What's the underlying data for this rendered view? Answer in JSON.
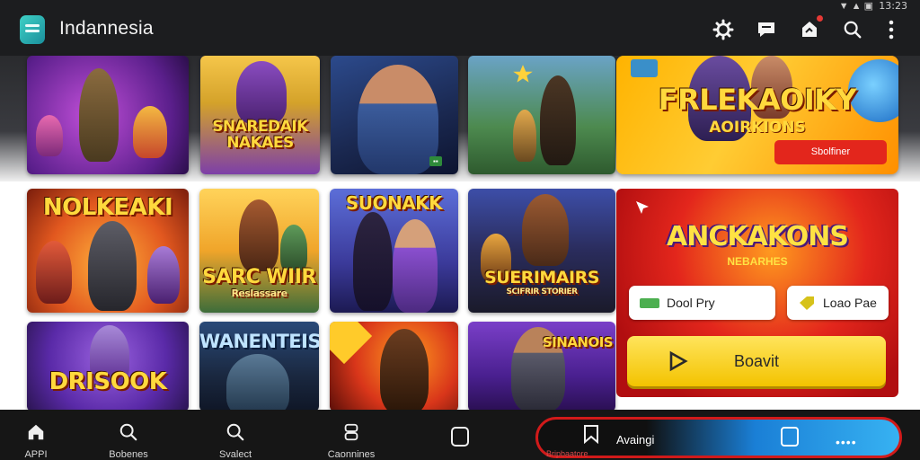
{
  "status": {
    "time": "13:23"
  },
  "header": {
    "title": "Indannesia"
  },
  "icons": {
    "settings": "settings-icon",
    "chat": "chat-icon",
    "notifications": "notifications-icon",
    "search": "search-icon",
    "more": "more-vertical-icon"
  },
  "row1": [
    {
      "title": "",
      "tag": ""
    },
    {
      "title": "SNAREDAIK NAKAES",
      "tag": ""
    },
    {
      "title": "",
      "tag": ""
    },
    {
      "title": "",
      "tag": ""
    }
  ],
  "featured": {
    "title": "FRLEKAOIKY",
    "subtitle": "AOIRKIONS",
    "button_label": "Sbolfiner"
  },
  "row2": [
    {
      "title": "NOLKEAKI"
    },
    {
      "title": "SARC WIIR",
      "subtitle": "Reslassare"
    },
    {
      "title": "SUONAKK"
    },
    {
      "title": "SUERIMAIRS",
      "subtitle": "SCIFRIR STORIER"
    }
  ],
  "row3": [
    {
      "title": "DRISOOK"
    },
    {
      "title": "WANENTEIS"
    },
    {
      "title": ""
    },
    {
      "title": "SINANOIS"
    }
  ],
  "promo": {
    "title": "ANCKAKONS",
    "subtitle": "NEBARHES"
  },
  "pills": [
    {
      "label": "Dool Pry"
    },
    {
      "label": "Loao Pae"
    }
  ],
  "play_button": {
    "label": "Boavit"
  },
  "nav": {
    "items": [
      {
        "label": "APPI"
      },
      {
        "label": "Bobenes"
      },
      {
        "label": "Svalect"
      },
      {
        "label": "Caonnines"
      }
    ],
    "active_label": "Avaingi",
    "active_sub": "Bripbaatore",
    "more": "••••"
  }
}
